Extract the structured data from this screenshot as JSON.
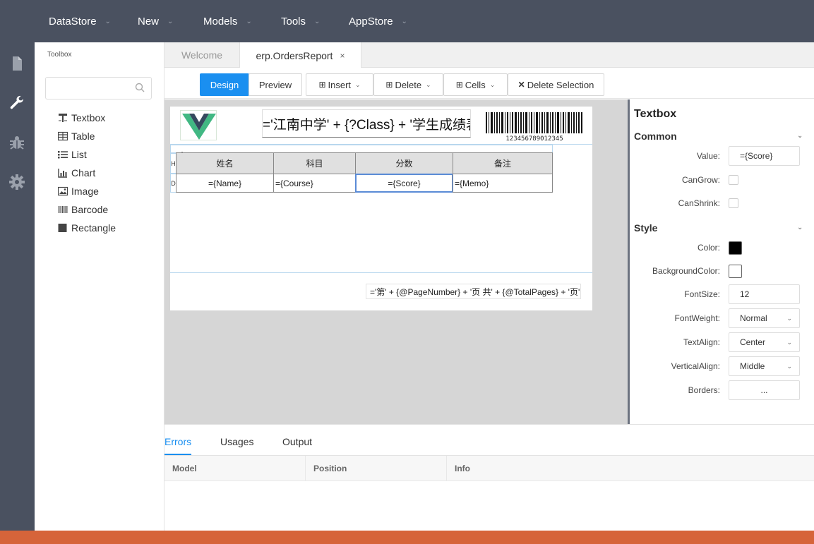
{
  "topmenu": {
    "items": [
      {
        "label": "DataStore"
      },
      {
        "label": "New"
      },
      {
        "label": "Models"
      },
      {
        "label": "Tools"
      },
      {
        "label": "AppStore"
      }
    ]
  },
  "iconbar": {
    "icons": [
      "file-icon",
      "wrench-icon",
      "bug-icon",
      "gear-icon"
    ],
    "active_color": "#ffffff",
    "inactive_color": "#9aa0ab"
  },
  "toolbox": {
    "title": "Toolbox",
    "search_placeholder": "",
    "items": [
      {
        "label": "Textbox",
        "icon": "textbox-icon"
      },
      {
        "label": "Table",
        "icon": "table-icon"
      },
      {
        "label": "List",
        "icon": "list-icon"
      },
      {
        "label": "Chart",
        "icon": "chart-icon"
      },
      {
        "label": "Image",
        "icon": "image-icon"
      },
      {
        "label": "Barcode",
        "icon": "barcode-icon"
      },
      {
        "label": "Rectangle",
        "icon": "rectangle-icon"
      }
    ]
  },
  "tabs": {
    "welcome": "Welcome",
    "orders": "erp.OrdersReport",
    "close": "×"
  },
  "toolbar": {
    "design": "Design",
    "preview": "Preview",
    "insert": "Insert",
    "delete": "Delete",
    "cells": "Cells",
    "delete_selection": "Delete Selection"
  },
  "report": {
    "title_expr": "='江南中学' + {?Class} + '学生成绩表'",
    "barcode_text": "123456789012345",
    "header_cells": [
      "姓名",
      "科目",
      "分数",
      "备注"
    ],
    "detail_cells": [
      "={Name}",
      "={Course}",
      "={Score}",
      "={Memo}"
    ],
    "row_markers": {
      "header": "H",
      "detail": "D"
    },
    "footer_expr": "='第' + {@PageNumber} + '页 共' + {@TotalPages} + '页'"
  },
  "props": {
    "title": "Textbox",
    "common_section": "Common",
    "style_section": "Style",
    "value_label": "Value:",
    "value": "={Score}",
    "cangrow_label": "CanGrow:",
    "canshrink_label": "CanShrink:",
    "color_label": "Color:",
    "color_value": "#000000",
    "bgcolor_label": "BackgroundColor:",
    "bgcolor_value": "#ffffff",
    "fontsize_label": "FontSize:",
    "fontsize": "12",
    "fontweight_label": "FontWeight:",
    "fontweight": "Normal",
    "textalign_label": "TextAlign:",
    "textalign": "Center",
    "valign_label": "VerticalAlign:",
    "valign": "Middle",
    "borders_label": "Borders:",
    "borders": "..."
  },
  "bottom": {
    "tabs": [
      "Errors",
      "Usages",
      "Output"
    ],
    "columns": [
      "Model",
      "Position",
      "Info"
    ]
  },
  "colors": {
    "sidebar_bg": "#4a5160",
    "accent": "#1a8ff0",
    "statusbar": "#d6643a",
    "canvas_bg": "#d6d6d6"
  }
}
